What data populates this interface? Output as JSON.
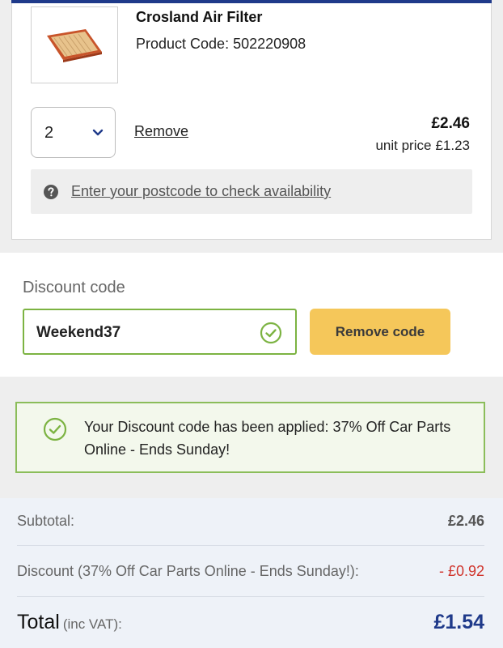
{
  "product": {
    "name": "Crosland Air Filter",
    "code_label": "Product Code:",
    "code": "502220908",
    "quantity": "2",
    "remove_label": "Remove",
    "price": "£2.46",
    "unit_price_label": "unit price",
    "unit_price": "£1.23",
    "availability_link": "Enter your postcode to check availability",
    "image_icon": "air-filter-icon",
    "help_icon": "question-circle-icon"
  },
  "discount": {
    "label": "Discount code",
    "value": "Weekend37",
    "remove_button": "Remove code",
    "check_icon": "check-circle-icon"
  },
  "message": {
    "text": "Your Discount code has been applied: 37% Off Car Parts Online - Ends Sunday!",
    "icon": "check-circle-icon"
  },
  "totals": {
    "subtotal_label": "Subtotal:",
    "subtotal_value": "£2.46",
    "discount_label": "Discount (37% Off Car Parts Online - Ends Sunday!):",
    "discount_value": "- £0.92",
    "total_label": "Total",
    "total_suffix": "(inc VAT):",
    "total_value": "£1.54"
  },
  "colors": {
    "brand_blue": "#1f3a8a",
    "success_green": "#8bbd5a",
    "button_yellow": "#f5c75a",
    "discount_red": "#d0342c"
  }
}
